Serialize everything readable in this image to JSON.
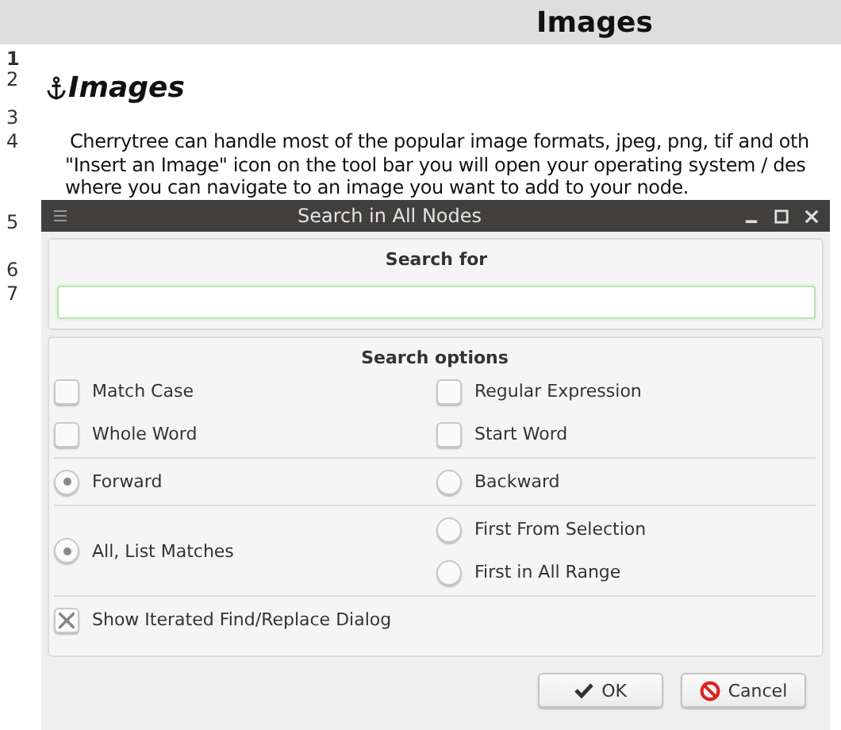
{
  "header": {
    "title": "Images"
  },
  "editor": {
    "lines": [
      {
        "number": "1",
        "current": true,
        "kind": "blank"
      },
      {
        "number": "2",
        "current": false,
        "kind": "heading",
        "text": "Images"
      },
      {
        "number": "3",
        "current": false,
        "kind": "blank"
      },
      {
        "number": "4",
        "current": false,
        "kind": "paragraph",
        "text_lines": [
          "Cherrytree can handle most of the popular image formats, jpeg, png, tif and oth",
          "\"Insert an Image\" icon on the tool bar you will open your operating system / des",
          "where you can navigate to an image you want to add to your node."
        ]
      },
      {
        "number": "5",
        "current": false,
        "kind": "hidden"
      },
      {
        "number": "6",
        "current": false,
        "kind": "blank"
      },
      {
        "number": "7",
        "current": false,
        "kind": "blank"
      }
    ]
  },
  "dialog": {
    "title": "Search in All Nodes",
    "search_for": {
      "label": "Search for"
    },
    "search_options": {
      "label": "Search options",
      "sections": [
        {
          "left": [
            {
              "kind": "checkbox",
              "label": "Match Case",
              "checked": false
            },
            {
              "kind": "checkbox",
              "label": "Whole Word",
              "checked": false
            }
          ],
          "right": [
            {
              "kind": "checkbox",
              "label": "Regular Expression",
              "checked": false
            },
            {
              "kind": "checkbox",
              "label": "Start Word",
              "checked": false
            }
          ]
        },
        {
          "left": [
            {
              "kind": "radio",
              "label": "Forward",
              "checked": true
            }
          ],
          "right": [
            {
              "kind": "radio",
              "label": "Backward",
              "checked": false
            }
          ]
        },
        {
          "left": [
            {
              "kind": "radio",
              "label": "All, List Matches",
              "checked": true
            }
          ],
          "right": [
            {
              "kind": "radio",
              "label": "First From Selection",
              "checked": false
            },
            {
              "kind": "radio",
              "label": "First in All Range",
              "checked": false
            }
          ]
        },
        {
          "left": [
            {
              "kind": "checkbox",
              "label": "Show Iterated Find/Replace Dialog",
              "checked": true
            }
          ]
        }
      ]
    },
    "buttons": [
      {
        "kind": "ok",
        "label": "OK"
      },
      {
        "kind": "cancel",
        "label": "Cancel"
      }
    ]
  }
}
